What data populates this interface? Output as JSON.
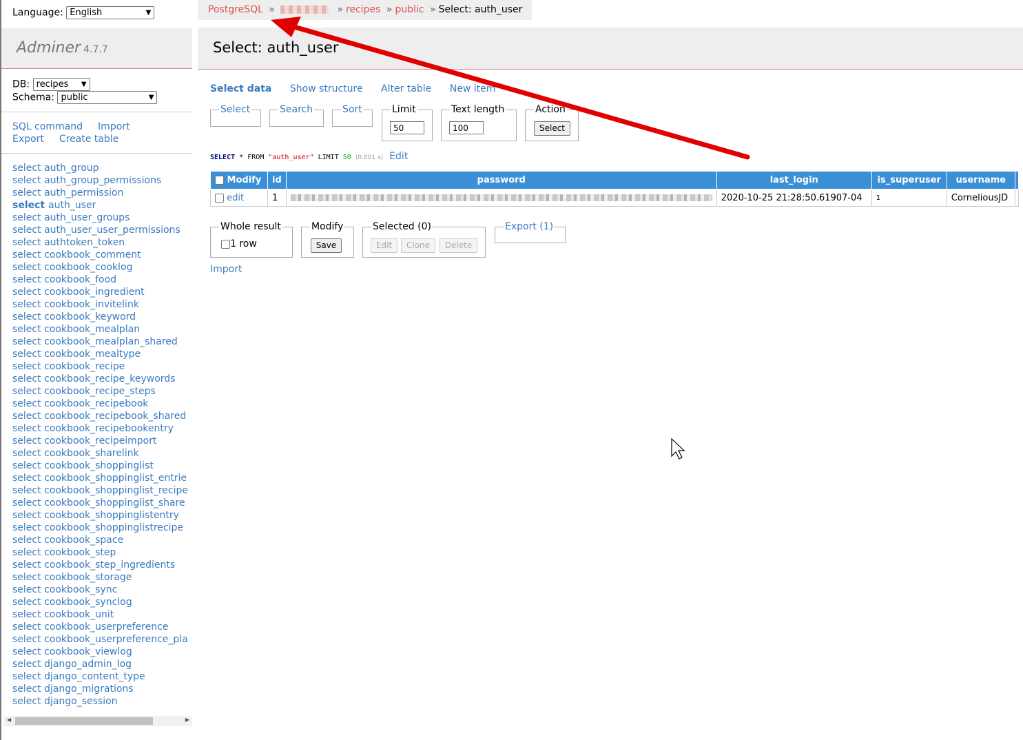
{
  "language": {
    "label": "Language:",
    "value": "English"
  },
  "brand": {
    "name": "Adminer",
    "version": "4.7.7"
  },
  "db": {
    "label": "DB:",
    "value": "recipes"
  },
  "schema": {
    "label": "Schema:",
    "value": "public"
  },
  "menu_links": [
    "SQL command",
    "Import",
    "Export",
    "Create table"
  ],
  "tables": [
    {
      "prefix": "select",
      "name": "auth_group"
    },
    {
      "prefix": "select",
      "name": "auth_group_permissions"
    },
    {
      "prefix": "select",
      "name": "auth_permission"
    },
    {
      "prefix": "select",
      "name": "auth_user",
      "active": true
    },
    {
      "prefix": "select",
      "name": "auth_user_groups"
    },
    {
      "prefix": "select",
      "name": "auth_user_user_permissions"
    },
    {
      "prefix": "select",
      "name": "authtoken_token"
    },
    {
      "prefix": "select",
      "name": "cookbook_comment"
    },
    {
      "prefix": "select",
      "name": "cookbook_cooklog"
    },
    {
      "prefix": "select",
      "name": "cookbook_food"
    },
    {
      "prefix": "select",
      "name": "cookbook_ingredient"
    },
    {
      "prefix": "select",
      "name": "cookbook_invitelink"
    },
    {
      "prefix": "select",
      "name": "cookbook_keyword"
    },
    {
      "prefix": "select",
      "name": "cookbook_mealplan"
    },
    {
      "prefix": "select",
      "name": "cookbook_mealplan_shared"
    },
    {
      "prefix": "select",
      "name": "cookbook_mealtype"
    },
    {
      "prefix": "select",
      "name": "cookbook_recipe"
    },
    {
      "prefix": "select",
      "name": "cookbook_recipe_keywords"
    },
    {
      "prefix": "select",
      "name": "cookbook_recipe_steps"
    },
    {
      "prefix": "select",
      "name": "cookbook_recipebook"
    },
    {
      "prefix": "select",
      "name": "cookbook_recipebook_shared"
    },
    {
      "prefix": "select",
      "name": "cookbook_recipebookentry"
    },
    {
      "prefix": "select",
      "name": "cookbook_recipeimport"
    },
    {
      "prefix": "select",
      "name": "cookbook_sharelink"
    },
    {
      "prefix": "select",
      "name": "cookbook_shoppinglist"
    },
    {
      "prefix": "select",
      "name": "cookbook_shoppinglist_entrie"
    },
    {
      "prefix": "select",
      "name": "cookbook_shoppinglist_recipe"
    },
    {
      "prefix": "select",
      "name": "cookbook_shoppinglist_share"
    },
    {
      "prefix": "select",
      "name": "cookbook_shoppinglistentry"
    },
    {
      "prefix": "select",
      "name": "cookbook_shoppinglistrecipe"
    },
    {
      "prefix": "select",
      "name": "cookbook_space"
    },
    {
      "prefix": "select",
      "name": "cookbook_step"
    },
    {
      "prefix": "select",
      "name": "cookbook_step_ingredients"
    },
    {
      "prefix": "select",
      "name": "cookbook_storage"
    },
    {
      "prefix": "select",
      "name": "cookbook_sync"
    },
    {
      "prefix": "select",
      "name": "cookbook_synclog"
    },
    {
      "prefix": "select",
      "name": "cookbook_unit"
    },
    {
      "prefix": "select",
      "name": "cookbook_userpreference"
    },
    {
      "prefix": "select",
      "name": "cookbook_userpreference_pla"
    },
    {
      "prefix": "select",
      "name": "cookbook_viewlog"
    },
    {
      "prefix": "select",
      "name": "django_admin_log"
    },
    {
      "prefix": "select",
      "name": "django_content_type"
    },
    {
      "prefix": "select",
      "name": "django_migrations"
    },
    {
      "prefix": "select",
      "name": "django_session"
    }
  ],
  "breadcrumb": {
    "driver": "PostgreSQL",
    "sep": "»",
    "db": "recipes",
    "schema": "public",
    "current": "Select: auth_user"
  },
  "page_title": "Select: auth_user",
  "tabs": {
    "select_data": "Select data",
    "show_structure": "Show structure",
    "alter_table": "Alter table",
    "new_item": "New item"
  },
  "filters": {
    "select": "Select",
    "search": "Search",
    "sort": "Sort",
    "limit_label": "Limit",
    "limit_value": "50",
    "text_length_label": "Text length",
    "text_length_value": "100",
    "action_label": "Action",
    "action_button": "Select"
  },
  "query": {
    "select": "SELECT",
    "star": "*",
    "from": "FROM",
    "table": "\"auth_user\"",
    "limit": "LIMIT",
    "limit_n": "50",
    "time": "(0.001 s)",
    "edit": "Edit"
  },
  "grid": {
    "modify_header": "Modify",
    "columns": [
      "id",
      "password",
      "last_login",
      "is_superuser",
      "username"
    ],
    "rows": [
      {
        "edit": "edit",
        "id": "1",
        "last_login": "2020-10-25 21:28:50.61907-04",
        "is_superuser": "1",
        "username": "CorneliousJD"
      }
    ]
  },
  "bottom": {
    "whole_result": "Whole result",
    "row_count": "1 row",
    "modify": "Modify",
    "save": "Save",
    "selected": "Selected (0)",
    "edit": "Edit",
    "clone": "Clone",
    "delete": "Delete",
    "export": "Export (1)",
    "import": "Import"
  },
  "annotation_color": "#e00000"
}
